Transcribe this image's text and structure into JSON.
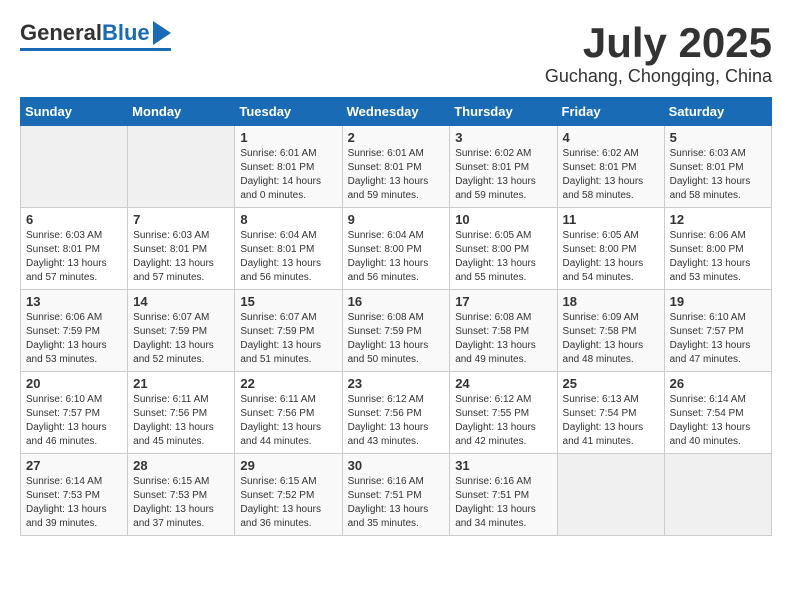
{
  "header": {
    "logo": {
      "general": "General",
      "blue": "Blue"
    },
    "month": "July 2025",
    "location": "Guchang, Chongqing, China"
  },
  "weekdays": [
    "Sunday",
    "Monday",
    "Tuesday",
    "Wednesday",
    "Thursday",
    "Friday",
    "Saturday"
  ],
  "weeks": [
    [
      {
        "day": "",
        "info": ""
      },
      {
        "day": "",
        "info": ""
      },
      {
        "day": "1",
        "info": "Sunrise: 6:01 AM\nSunset: 8:01 PM\nDaylight: 14 hours\nand 0 minutes."
      },
      {
        "day": "2",
        "info": "Sunrise: 6:01 AM\nSunset: 8:01 PM\nDaylight: 13 hours\nand 59 minutes."
      },
      {
        "day": "3",
        "info": "Sunrise: 6:02 AM\nSunset: 8:01 PM\nDaylight: 13 hours\nand 59 minutes."
      },
      {
        "day": "4",
        "info": "Sunrise: 6:02 AM\nSunset: 8:01 PM\nDaylight: 13 hours\nand 58 minutes."
      },
      {
        "day": "5",
        "info": "Sunrise: 6:03 AM\nSunset: 8:01 PM\nDaylight: 13 hours\nand 58 minutes."
      }
    ],
    [
      {
        "day": "6",
        "info": "Sunrise: 6:03 AM\nSunset: 8:01 PM\nDaylight: 13 hours\nand 57 minutes."
      },
      {
        "day": "7",
        "info": "Sunrise: 6:03 AM\nSunset: 8:01 PM\nDaylight: 13 hours\nand 57 minutes."
      },
      {
        "day": "8",
        "info": "Sunrise: 6:04 AM\nSunset: 8:01 PM\nDaylight: 13 hours\nand 56 minutes."
      },
      {
        "day": "9",
        "info": "Sunrise: 6:04 AM\nSunset: 8:00 PM\nDaylight: 13 hours\nand 56 minutes."
      },
      {
        "day": "10",
        "info": "Sunrise: 6:05 AM\nSunset: 8:00 PM\nDaylight: 13 hours\nand 55 minutes."
      },
      {
        "day": "11",
        "info": "Sunrise: 6:05 AM\nSunset: 8:00 PM\nDaylight: 13 hours\nand 54 minutes."
      },
      {
        "day": "12",
        "info": "Sunrise: 6:06 AM\nSunset: 8:00 PM\nDaylight: 13 hours\nand 53 minutes."
      }
    ],
    [
      {
        "day": "13",
        "info": "Sunrise: 6:06 AM\nSunset: 7:59 PM\nDaylight: 13 hours\nand 53 minutes."
      },
      {
        "day": "14",
        "info": "Sunrise: 6:07 AM\nSunset: 7:59 PM\nDaylight: 13 hours\nand 52 minutes."
      },
      {
        "day": "15",
        "info": "Sunrise: 6:07 AM\nSunset: 7:59 PM\nDaylight: 13 hours\nand 51 minutes."
      },
      {
        "day": "16",
        "info": "Sunrise: 6:08 AM\nSunset: 7:59 PM\nDaylight: 13 hours\nand 50 minutes."
      },
      {
        "day": "17",
        "info": "Sunrise: 6:08 AM\nSunset: 7:58 PM\nDaylight: 13 hours\nand 49 minutes."
      },
      {
        "day": "18",
        "info": "Sunrise: 6:09 AM\nSunset: 7:58 PM\nDaylight: 13 hours\nand 48 minutes."
      },
      {
        "day": "19",
        "info": "Sunrise: 6:10 AM\nSunset: 7:57 PM\nDaylight: 13 hours\nand 47 minutes."
      }
    ],
    [
      {
        "day": "20",
        "info": "Sunrise: 6:10 AM\nSunset: 7:57 PM\nDaylight: 13 hours\nand 46 minutes."
      },
      {
        "day": "21",
        "info": "Sunrise: 6:11 AM\nSunset: 7:56 PM\nDaylight: 13 hours\nand 45 minutes."
      },
      {
        "day": "22",
        "info": "Sunrise: 6:11 AM\nSunset: 7:56 PM\nDaylight: 13 hours\nand 44 minutes."
      },
      {
        "day": "23",
        "info": "Sunrise: 6:12 AM\nSunset: 7:56 PM\nDaylight: 13 hours\nand 43 minutes."
      },
      {
        "day": "24",
        "info": "Sunrise: 6:12 AM\nSunset: 7:55 PM\nDaylight: 13 hours\nand 42 minutes."
      },
      {
        "day": "25",
        "info": "Sunrise: 6:13 AM\nSunset: 7:54 PM\nDaylight: 13 hours\nand 41 minutes."
      },
      {
        "day": "26",
        "info": "Sunrise: 6:14 AM\nSunset: 7:54 PM\nDaylight: 13 hours\nand 40 minutes."
      }
    ],
    [
      {
        "day": "27",
        "info": "Sunrise: 6:14 AM\nSunset: 7:53 PM\nDaylight: 13 hours\nand 39 minutes."
      },
      {
        "day": "28",
        "info": "Sunrise: 6:15 AM\nSunset: 7:53 PM\nDaylight: 13 hours\nand 37 minutes."
      },
      {
        "day": "29",
        "info": "Sunrise: 6:15 AM\nSunset: 7:52 PM\nDaylight: 13 hours\nand 36 minutes."
      },
      {
        "day": "30",
        "info": "Sunrise: 6:16 AM\nSunset: 7:51 PM\nDaylight: 13 hours\nand 35 minutes."
      },
      {
        "day": "31",
        "info": "Sunrise: 6:16 AM\nSunset: 7:51 PM\nDaylight: 13 hours\nand 34 minutes."
      },
      {
        "day": "",
        "info": ""
      },
      {
        "day": "",
        "info": ""
      }
    ]
  ]
}
